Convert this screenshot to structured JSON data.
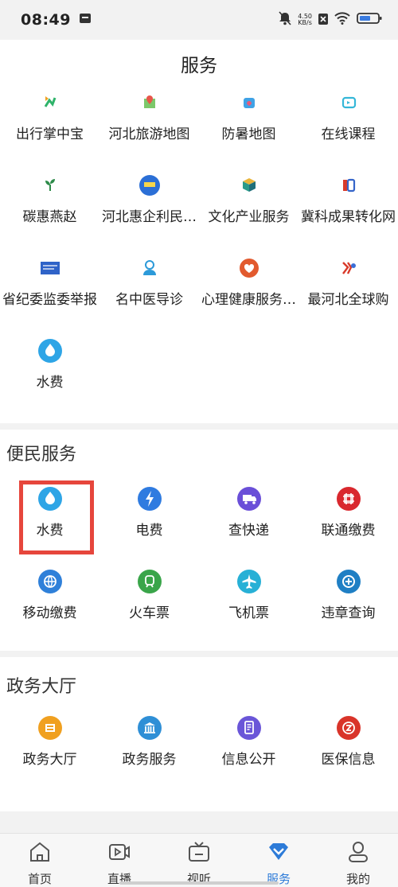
{
  "status": {
    "time": "08:49",
    "speed_value": "4.50",
    "speed_unit": "KB/s"
  },
  "header": {
    "title": "服务"
  },
  "top_services": [
    {
      "label": "出行掌中宝",
      "icon": "route-icon",
      "color": "#2fb36a"
    },
    {
      "label": "河北旅游地图",
      "icon": "map-icon",
      "color": "#e8564a"
    },
    {
      "label": "防暑地图",
      "icon": "sunshade-map-icon",
      "color": "#3fa2e6"
    },
    {
      "label": "在线课程",
      "icon": "online-course-icon",
      "color": "#35b7d8"
    },
    {
      "label": "碳惠燕赵",
      "icon": "sprout-icon",
      "color": "#2e8b4a"
    },
    {
      "label": "河北惠企利民…",
      "icon": "enterprise-icon",
      "color": "#2b6fd6"
    },
    {
      "label": "文化产业服务",
      "icon": "culture-cube-icon",
      "color": "#2a9a8a"
    },
    {
      "label": "冀科成果转化网",
      "icon": "tech-transfer-icon",
      "color": "#3565c9"
    },
    {
      "label": "省纪委监委举报",
      "icon": "discipline-report-icon",
      "color": "#2f63c8"
    },
    {
      "label": "名中医导诊",
      "icon": "doctor-icon",
      "color": "#2c9ad9"
    },
    {
      "label": "心理健康服务…",
      "icon": "heart-care-icon",
      "color": "#e25a2e"
    },
    {
      "label": "最河北全球购",
      "icon": "global-shop-icon",
      "color": "#d93a2a"
    },
    {
      "label": "水费",
      "icon": "water-drop-icon",
      "color": "#2ea5e6"
    }
  ],
  "convenience": {
    "title": "便民服务",
    "items": [
      {
        "label": "水费",
        "icon": "water-drop-icon",
        "color": "#2ea5e6"
      },
      {
        "label": "电费",
        "icon": "lightning-icon",
        "color": "#2f7be0"
      },
      {
        "label": "查快递",
        "icon": "delivery-truck-icon",
        "color": "#6a4fd8"
      },
      {
        "label": "联通缴费",
        "icon": "unicom-icon",
        "color": "#d9282e"
      },
      {
        "label": "移动缴费",
        "icon": "mobile-globe-icon",
        "color": "#2f80d9"
      },
      {
        "label": "火车票",
        "icon": "train-icon",
        "color": "#3aa54a"
      },
      {
        "label": "飞机票",
        "icon": "airplane-icon",
        "color": "#27b0d6"
      },
      {
        "label": "违章查询",
        "icon": "traffic-violation-icon",
        "color": "#1f7fc4"
      }
    ]
  },
  "government": {
    "title": "政务大厅",
    "items": [
      {
        "label": "政务大厅",
        "icon": "hall-icon",
        "color": "#f0a020"
      },
      {
        "label": "政务服务",
        "icon": "government-building-icon",
        "color": "#2f8fd6"
      },
      {
        "label": "信息公开",
        "icon": "document-icon",
        "color": "#6a56d8"
      },
      {
        "label": "医保信息",
        "icon": "medical-insurance-icon",
        "color": "#d9342a"
      }
    ]
  },
  "tabbar": [
    {
      "label": "首页",
      "icon": "home-icon"
    },
    {
      "label": "直播",
      "icon": "live-play-icon"
    },
    {
      "label": "视听",
      "icon": "tv-icon"
    },
    {
      "label": "服务",
      "icon": "service-diamond-icon",
      "active": true
    },
    {
      "label": "我的",
      "icon": "profile-icon"
    }
  ],
  "colors": {
    "accent": "#2d7bd8",
    "highlight_box": "#e6463c"
  }
}
